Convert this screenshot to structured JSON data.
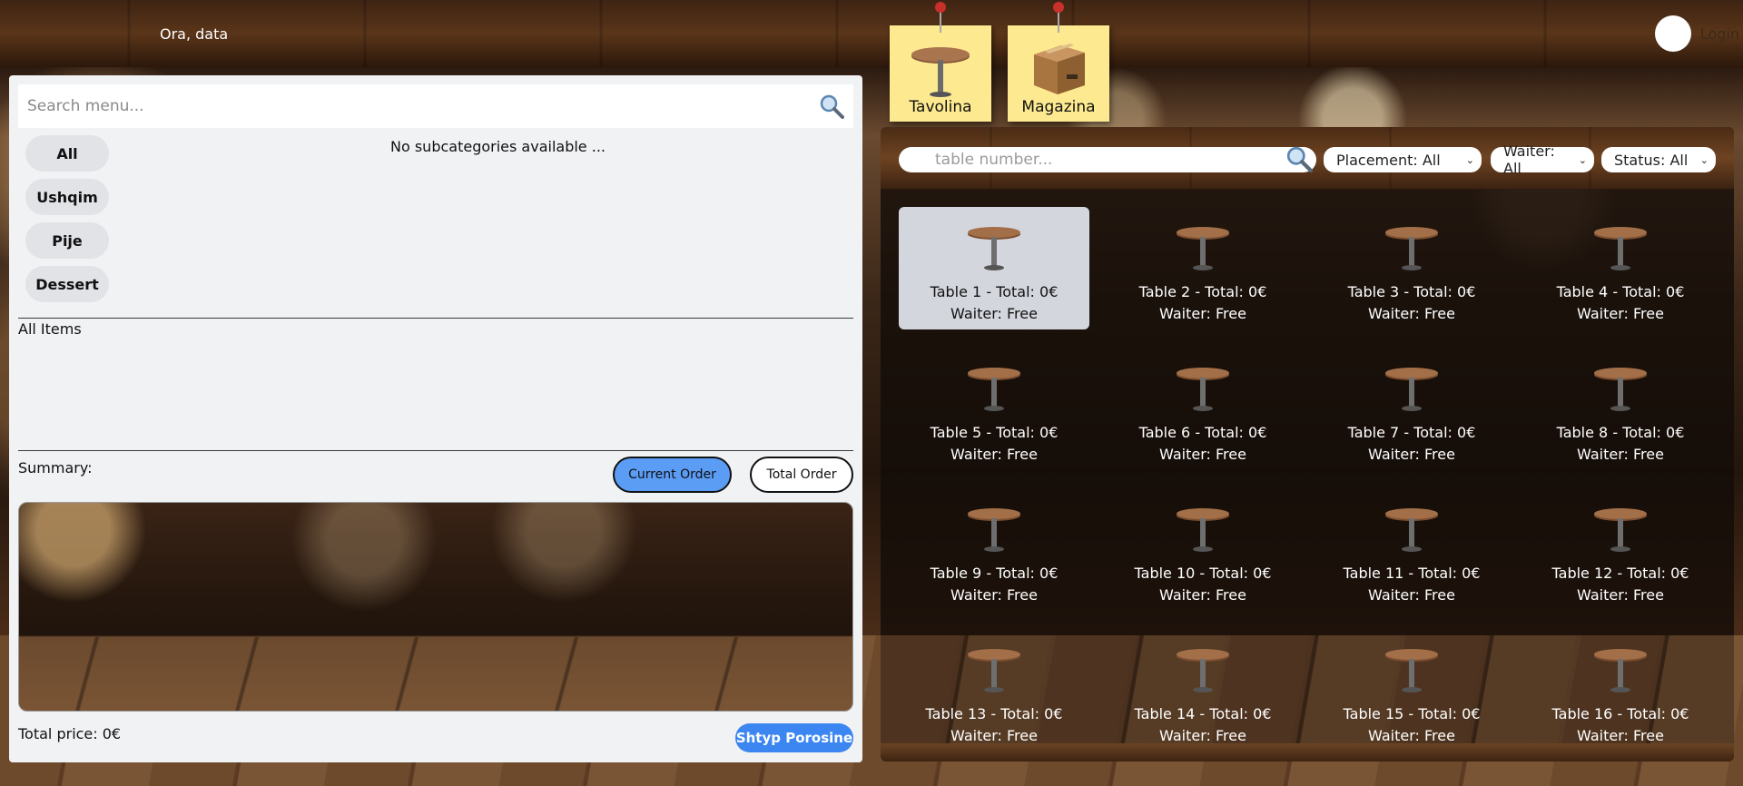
{
  "header": {
    "clock_label": "Ora, data",
    "login_label": "Login"
  },
  "notes": [
    {
      "label": "Tavolina",
      "icon": "table-icon"
    },
    {
      "label": "Magazina",
      "icon": "box-icon"
    }
  ],
  "menu": {
    "search_placeholder": "Search menu...",
    "categories": [
      "All",
      "Ushqim",
      "Pije",
      "Dessert"
    ],
    "subcategories_message": "No subcategories available ...",
    "items_label": "All Items",
    "summary_label": "Summary:",
    "current_order_label": "Current Order",
    "total_order_label": "Total Order",
    "total_price_label": "Total price: 0€",
    "print_button_label": "Shtyp Porosine"
  },
  "tables_panel": {
    "search_placeholder": "table number...",
    "filters": {
      "placement": "Placement: All",
      "waiter": "Waiter: All",
      "status": "Status: All"
    },
    "tables": [
      {
        "title": "Table 1 - Total: 0€",
        "waiter": "Waiter: Free",
        "selected": true
      },
      {
        "title": "Table 2 - Total: 0€",
        "waiter": "Waiter: Free"
      },
      {
        "title": "Table 3 - Total: 0€",
        "waiter": "Waiter: Free"
      },
      {
        "title": "Table 4 - Total: 0€",
        "waiter": "Waiter: Free"
      },
      {
        "title": "Table 5 - Total: 0€",
        "waiter": "Waiter: Free"
      },
      {
        "title": "Table 6 - Total: 0€",
        "waiter": "Waiter: Free"
      },
      {
        "title": "Table 7 - Total: 0€",
        "waiter": "Waiter: Free"
      },
      {
        "title": "Table 8 - Total: 0€",
        "waiter": "Waiter: Free"
      },
      {
        "title": "Table 9 - Total: 0€",
        "waiter": "Waiter: Free"
      },
      {
        "title": "Table 10 - Total: 0€",
        "waiter": "Waiter: Free"
      },
      {
        "title": "Table 11 - Total: 0€",
        "waiter": "Waiter: Free"
      },
      {
        "title": "Table 12 - Total: 0€",
        "waiter": "Waiter: Free"
      },
      {
        "title": "Table 13 - Total: 0€",
        "waiter": "Waiter: Free"
      },
      {
        "title": "Table 14 - Total: 0€",
        "waiter": "Waiter: Free"
      },
      {
        "title": "Table 15 - Total: 0€",
        "waiter": "Waiter: Free"
      },
      {
        "title": "Table 16 - Total: 0€",
        "waiter": "Waiter: Free"
      }
    ]
  },
  "colors": {
    "accent_blue": "#3b86f0",
    "active_toggle": "#5b9cf5",
    "note_yellow": "#fde98f",
    "selected_table": "#d4d6de"
  }
}
